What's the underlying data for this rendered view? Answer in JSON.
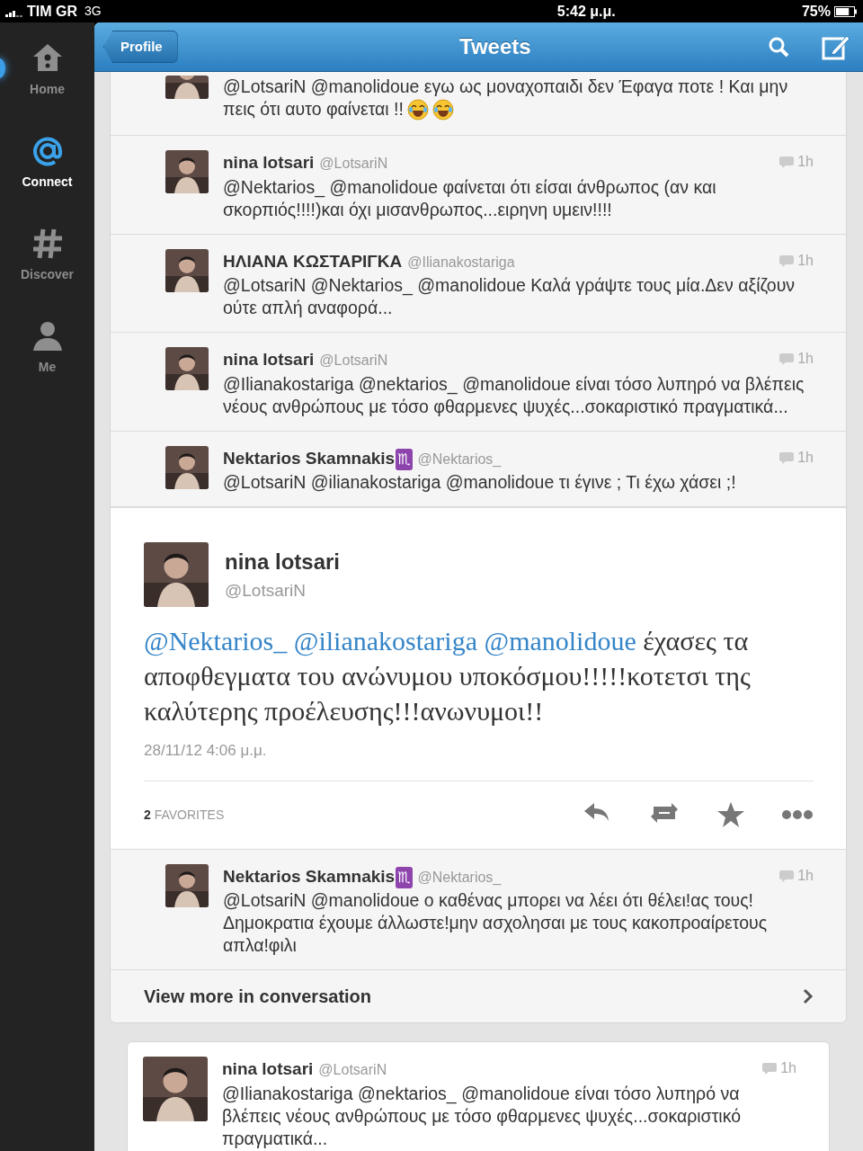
{
  "status_bar": {
    "carrier": "TIM GR",
    "network": "3G",
    "time": "5:42 μ.μ.",
    "battery": "75%"
  },
  "sidebar": {
    "items": [
      {
        "label": "Home",
        "kind": "home",
        "selected": false,
        "unread": true
      },
      {
        "label": "Connect",
        "kind": "mentions",
        "selected": true,
        "unread": false
      },
      {
        "label": "Discover",
        "kind": "discover",
        "selected": false,
        "unread": false
      },
      {
        "label": "Me",
        "kind": "profile",
        "selected": false,
        "unread": false
      }
    ]
  },
  "header": {
    "back": "Profile",
    "title": "Tweets"
  },
  "replies_above": [
    {
      "kind": "partial",
      "lines": [
        "@LotsariN @manolidoue εγω ως μοναχοπαιδι δεν Έφαγα ποτε ! Και μην",
        "πεις ότι αυτο φαίνεται !!"
      ],
      "emojis": [
        {
          "kind": "laughing"
        },
        {
          "kind": "laughing"
        }
      ]
    },
    {
      "kind": "full",
      "name": "nina lotsari",
      "handle": "@LotsariN",
      "time": "1h",
      "text": "@Nektarios_ @manolidoue φαίνεται ότι είσαι άνθρωπος (αν και σκορπιός!!!!)και όχι μισανθρωπος...ειρηνη υμειν!!!!"
    },
    {
      "kind": "full",
      "name": "ΗΛΙΑΝΑ ΚΩΣΤΑΡΙΓΚΑ",
      "handle": "@Ilianakostariga",
      "time": "1h",
      "text": "@LotsariN @Nektarios_ @manolidoue Καλά γράψτε τους μία.Δεν αξίζουν ούτε απλή αναφορά..."
    },
    {
      "kind": "full",
      "name": "nina lotsari",
      "handle": "@LotsariN",
      "time": "1h",
      "text": "@Ilianakostariga @nektarios_ @manolidoue είναι τόσο λυπηρό να βλέπεις νέους ανθρώπους με τόσο φθαρμενες ψυχές...σοκαριστικό πραγματικά..."
    },
    {
      "kind": "full",
      "name": "Nektarios Skamnakis",
      "badge": "♏",
      "handle": "@Nektarios_",
      "time": "1h",
      "text": "@LotsariN @ilianakostariga @manolidoue τι έγινε ; Τι έχω χάσει ;!"
    }
  ],
  "focused_tweet": {
    "name": "nina lotsari",
    "handle": "@LotsariN",
    "mentions": [
      "@Nektarios_",
      "@ilianakostariga",
      "@manolidoue"
    ],
    "text": "έχασες τα αποφθεγματα του ανώνυμου υποκόσμου!!!!!κοτετσι της καλύτερης προέλευσης!!!ανωνυμοι!!",
    "date": "28/11/12 4:06 μ.μ.",
    "favorites_count": "2",
    "favorites_label": "FAVORITES",
    "actions": [
      {
        "kind": "reply"
      },
      {
        "kind": "retweet"
      },
      {
        "kind": "favorite"
      },
      {
        "kind": "more"
      }
    ]
  },
  "replies_below": [
    {
      "kind": "full",
      "name": "Nektarios Skamnakis",
      "badge": "♏",
      "handle": "@Nektarios_",
      "time": "1h",
      "text": "@LotsariN @manolidoue ο καθένας μπορει να λέει ότι θέλει!ας τους! Δημοκρατια έχουμε άλλωστε!μην ασχολησαι με τους κακοπροαίρετους απλα!φιλι"
    }
  ],
  "view_more": "View more in conversation",
  "timeline": [
    {
      "kind": "full",
      "name": "nina lotsari",
      "handle": "@LotsariN",
      "time": "1h",
      "text": "@Ilianakostariga @nektarios_ @manolidoue είναι τόσο λυπηρό να βλέπεις νέους ανθρώπους με τόσο φθαρμενες ψυχές...σοκαριστικό πραγματικά..."
    }
  ]
}
